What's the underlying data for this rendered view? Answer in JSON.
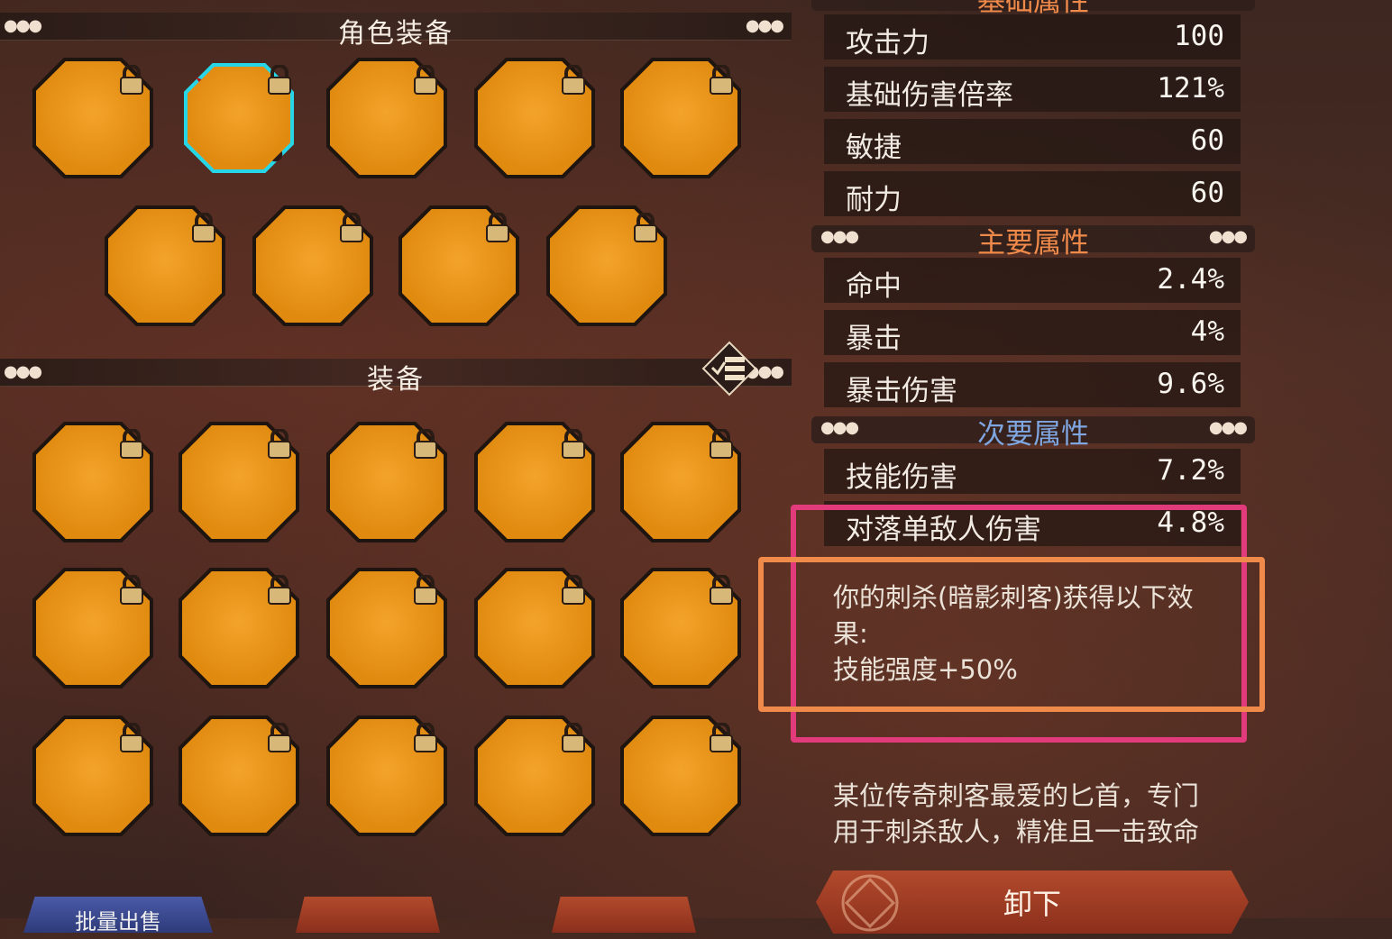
{
  "character_equipment": {
    "title": "角色装备"
  },
  "inventory": {
    "title": "装备"
  },
  "stats": {
    "base_header": "基础属性",
    "base": [
      {
        "label": "攻击力",
        "value": "100"
      },
      {
        "label": "基础伤害倍率",
        "value": "121%"
      },
      {
        "label": "敏捷",
        "value": "60"
      },
      {
        "label": "耐力",
        "value": "60"
      }
    ],
    "main_header": "主要属性",
    "main": [
      {
        "label": "命中",
        "value": "2.4%"
      },
      {
        "label": "暴击",
        "value": "4%"
      },
      {
        "label": "暴击伤害",
        "value": "9.6%"
      }
    ],
    "secondary_header": "次要属性",
    "secondary": [
      {
        "label": "技能伤害",
        "value": "7.2%"
      },
      {
        "label": "对落单敌人伤害",
        "value": "4.8%"
      }
    ]
  },
  "effect": {
    "line1": "你的刺杀(暗影刺客)获得以下效",
    "line2": "果:",
    "line3": "技能强度+50%"
  },
  "flavor": {
    "line1": "某位传奇刺客最爱的匕首，专门",
    "line2": "用于刺杀敌人，精准且一击致命"
  },
  "buttons": {
    "unequip": "卸下",
    "bottom_left": "批量出售"
  },
  "colors": {
    "slot_orange": "#e89316",
    "selected_cyan": "#27d6e6",
    "header_orange": "#f08a4a",
    "header_blue": "#7fa6e0",
    "highlight_pink": "#e23b7c",
    "highlight_orange": "#f08a4a"
  }
}
